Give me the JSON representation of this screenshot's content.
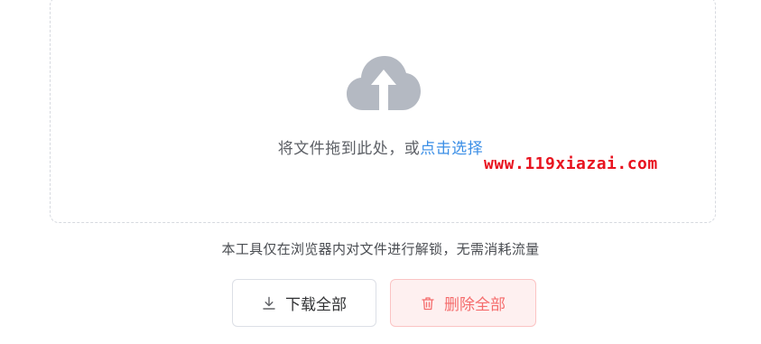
{
  "dropzone": {
    "icon": "cloud-upload-icon",
    "prompt": "将文件拖到此处，或",
    "link_label": "点击选择"
  },
  "watermark": "www.119xiazai.com",
  "notice": "本工具仅在浏览器内对文件进行解锁，无需消耗流量",
  "buttons": {
    "download_all": {
      "icon": "download-icon",
      "label": "下载全部"
    },
    "delete_all": {
      "icon": "trash-icon",
      "label": "删除全部"
    }
  },
  "colors": {
    "link": "#3a8ee6",
    "watermark": "#e8131f",
    "danger_text": "#f56c6c",
    "danger_bg": "#fef0f0",
    "danger_border": "#fbc4c4",
    "icon_gray": "#b4b9c2"
  }
}
